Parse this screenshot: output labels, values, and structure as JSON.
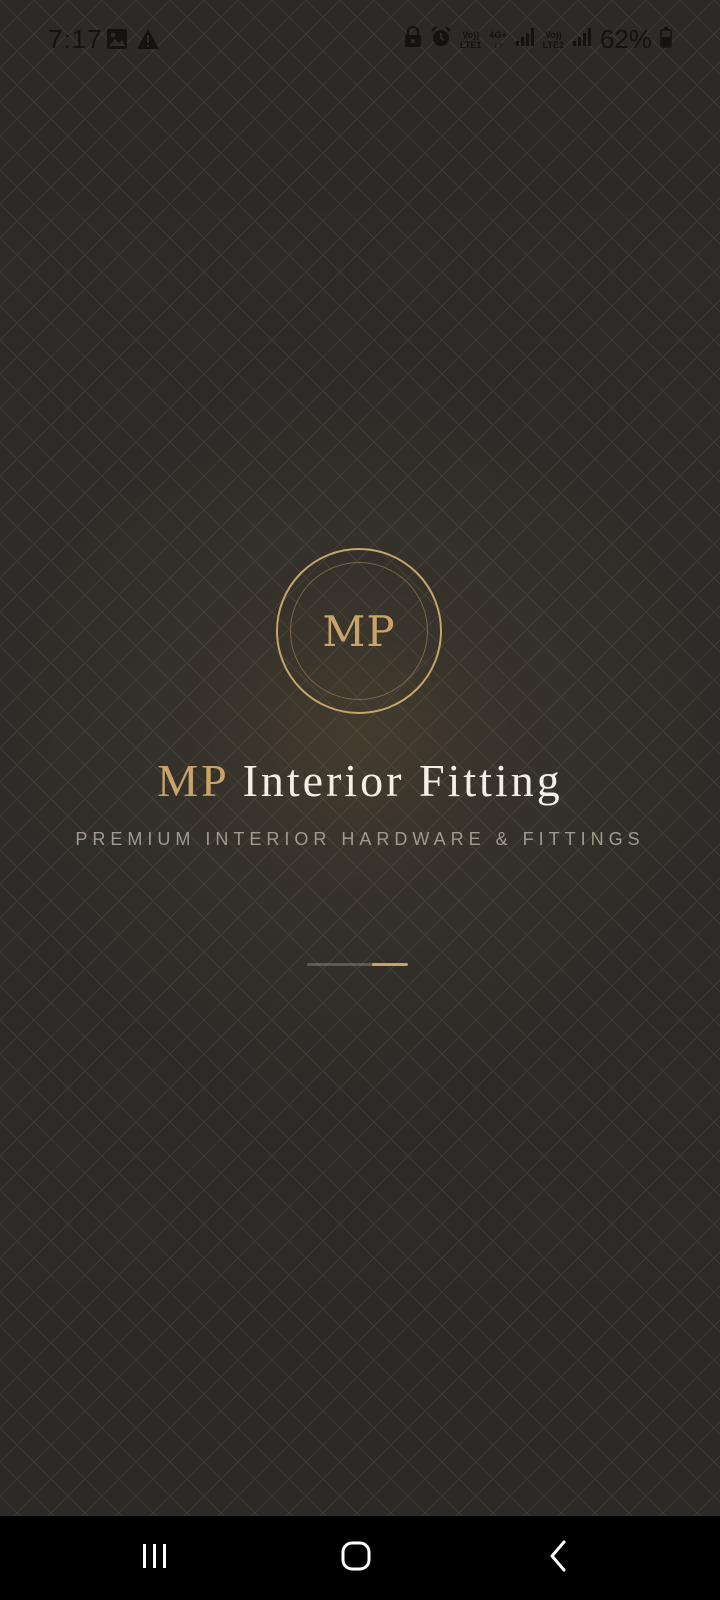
{
  "status_bar": {
    "time": "7:17",
    "left_icons": [
      "image-icon",
      "warning-icon"
    ],
    "right_icons": [
      "lock-icon",
      "alarm-icon"
    ],
    "sim1": {
      "line1": "Vo))",
      "line2": "LTE1"
    },
    "data_type": {
      "line1": "4G+",
      "line2": "↓↑"
    },
    "sim2": {
      "line1": "Vo))",
      "line2": "LTE2"
    },
    "battery_percent": "62%"
  },
  "splash": {
    "logo_initials": "MP",
    "brand_accent": "MP",
    "brand_rest": "Interior Fitting",
    "tagline": "PREMIUM INTERIOR HARDWARE & FITTINGS",
    "loader": {
      "progress_start": 0.64,
      "progress_end": 1.0
    }
  },
  "colors": {
    "background": "#2e2c28",
    "gold": "#c8a46c",
    "title_text": "#f4efe6",
    "tagline_text": "#a09a90",
    "nav_bar": "#000000"
  },
  "nav_bar": {
    "buttons": [
      "recent-apps-icon",
      "home-icon",
      "back-icon"
    ]
  }
}
